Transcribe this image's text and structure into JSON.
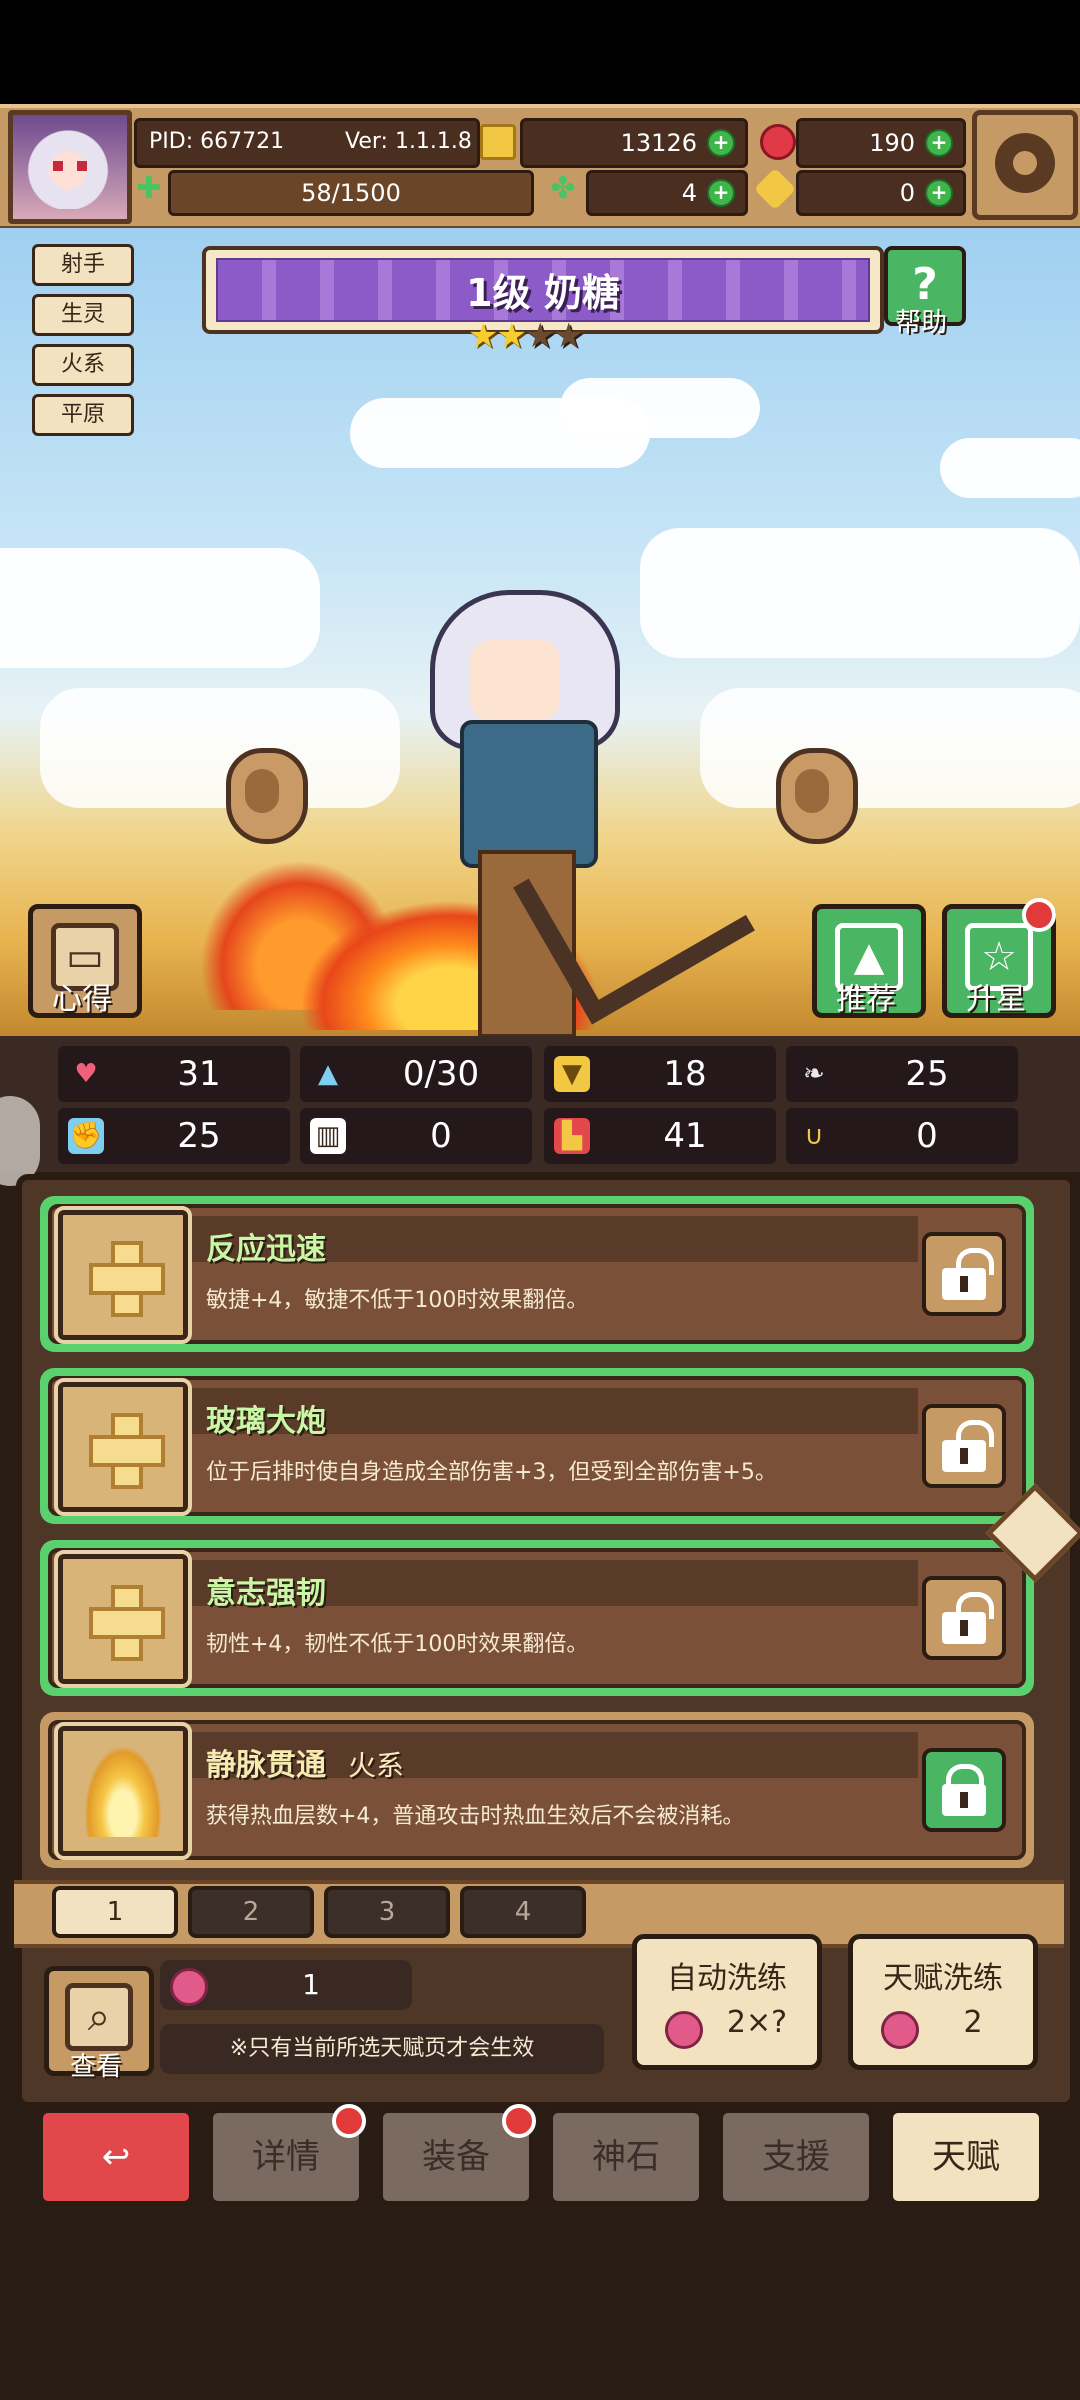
{
  "header": {
    "pid": "PID: 667721",
    "version": "Ver: 1.1.1.8",
    "coins": "13126",
    "gems": "190",
    "energy": "58/1500",
    "clover": "4",
    "key": "0"
  },
  "tags": [
    "射手",
    "生灵",
    "火系",
    "平原"
  ],
  "hero": {
    "title": "1级 奶糖",
    "stars_on": 2,
    "stars_total": 4,
    "help_label": "帮助"
  },
  "scene_buttons": {
    "notes_label": "心得",
    "recommend_label": "推荐",
    "upgrade_label": "升星"
  },
  "stats": [
    {
      "icon": "heart-icon",
      "value": "31"
    },
    {
      "icon": "water-drop-icon",
      "value": "0/30"
    },
    {
      "icon": "armor-icon",
      "value": "18"
    },
    {
      "icon": "wing-icon",
      "value": "25"
    },
    {
      "icon": "fist-icon",
      "value": "25"
    },
    {
      "icon": "book-icon",
      "value": "0"
    },
    {
      "icon": "boot-icon",
      "value": "41"
    },
    {
      "icon": "horseshoe-icon",
      "value": "0"
    }
  ],
  "talents": [
    {
      "name": "反应迅速",
      "element": "",
      "desc": "敏捷+4，敏捷不低于100时效果翻倍。",
      "locked": false
    },
    {
      "name": "玻璃大炮",
      "element": "",
      "desc": "位于后排时使自身造成全部伤害+3，但受到全部伤害+5。",
      "locked": false
    },
    {
      "name": "意志强韧",
      "element": "",
      "desc": "韧性+4，韧性不低于100时效果翻倍。",
      "locked": false
    },
    {
      "name": "静脉贯通",
      "element": "火系",
      "desc": "获得热血层数+4，普通攻击时热血生效后不会被消耗。",
      "locked": true
    }
  ],
  "pages": [
    "1",
    "2",
    "3",
    "4"
  ],
  "footer": {
    "view_label": "查看",
    "seed_count": "1",
    "notice": "※只有当前所选天赋页才会生效",
    "auto_refine": {
      "label": "自动洗练",
      "cost": "2×?"
    },
    "talent_refine": {
      "label": "天赋洗练",
      "cost": "2"
    }
  },
  "nav": [
    "详情",
    "装备",
    "神石",
    "支援",
    "天赋"
  ],
  "colors": {
    "accent_green": "#5bd06e",
    "panel_brown": "#4e3726",
    "gold": "#f2c744"
  }
}
